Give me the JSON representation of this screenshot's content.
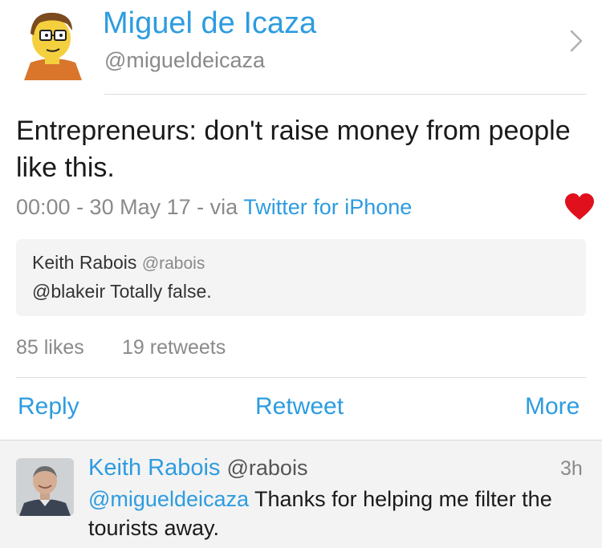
{
  "tweet": {
    "author_name": "Miguel de Icaza",
    "author_handle": "@migueldeicaza",
    "text": "Entrepreneurs: don't raise money from people like this.",
    "timestamp": "00:00 - 30 May 17",
    "via_word": "via",
    "source": "Twitter for iPhone",
    "liked": true,
    "likes": "85 likes",
    "retweets": "19 retweets"
  },
  "quoted": {
    "name": "Keith Rabois",
    "handle": "@rabois",
    "text": "@blakeir Totally false."
  },
  "actions": {
    "reply": "Reply",
    "retweet": "Retweet",
    "more": "More"
  },
  "reply": {
    "name": "Keith Rabois",
    "handle": "@rabois",
    "time": "3h",
    "mention": "@migueldeicaza",
    "text": "Thanks for helping me filter the tourists away."
  },
  "colors": {
    "link_blue": "#2d9ce0",
    "heart_red": "#e0101d"
  },
  "icons": {
    "chevron": "chevron-right-icon",
    "heart": "heart-icon"
  }
}
